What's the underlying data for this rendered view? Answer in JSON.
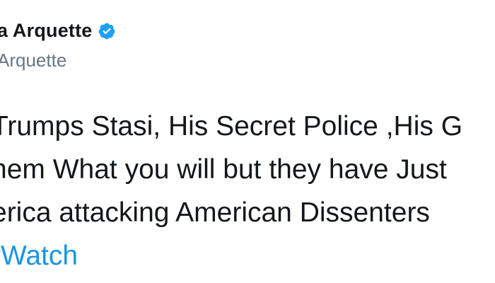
{
  "tweet": {
    "display_name": "a Arquette",
    "handle": "Arquette",
    "lines": [
      "Trumps Stasi, His Secret Police ,His G",
      "hem What you will but they have Just",
      "erica attacking American Dissenters"
    ],
    "hashtag": "rWatch"
  },
  "icons": {
    "verified": "verified-badge-icon"
  },
  "colors": {
    "text": "#14171a",
    "secondary": "#657786",
    "link": "#1b95e0",
    "verified": "#1da1f2"
  }
}
